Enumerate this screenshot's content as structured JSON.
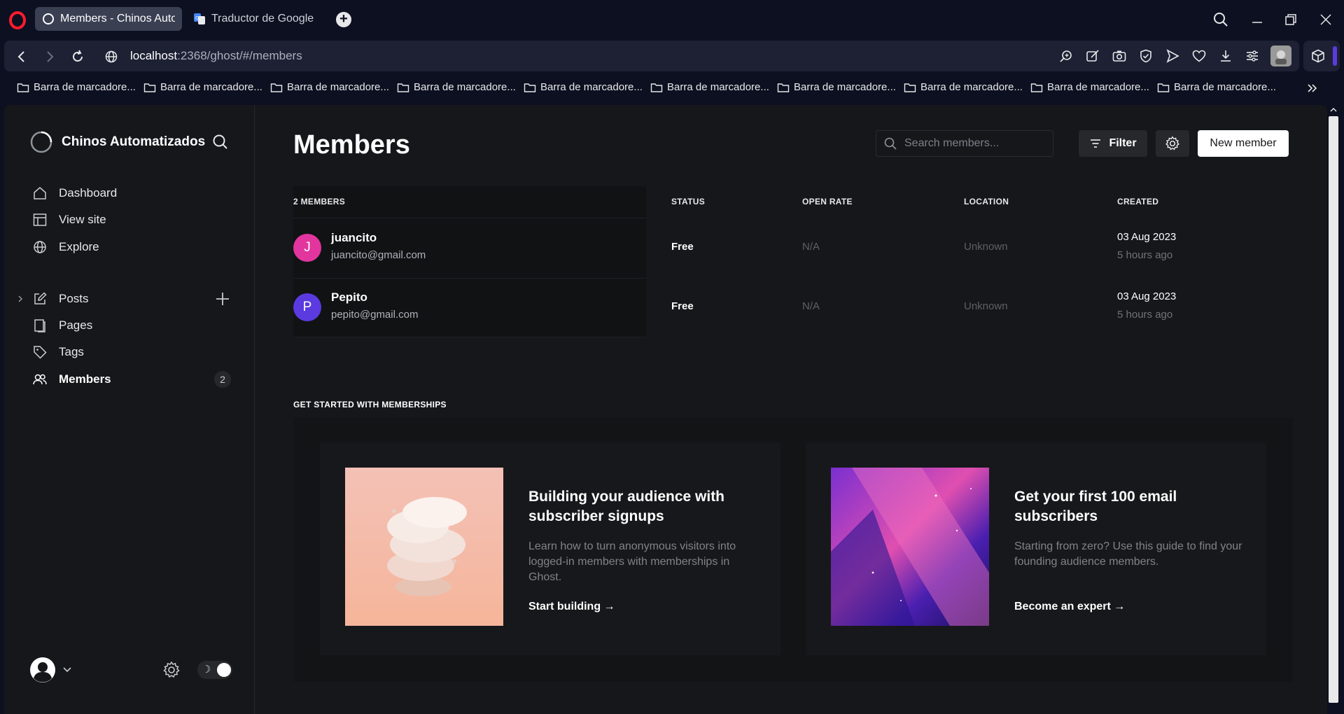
{
  "browser": {
    "tabs": [
      {
        "title": "Members - Chinos Autom",
        "active": true
      },
      {
        "title": "Traductor de Google",
        "active": false
      }
    ],
    "url_host": "localhost",
    "url_rest": ":2368/ghost/#/members",
    "bookmarks": [
      "Barra de marcadore...",
      "Barra de marcadore...",
      "Barra de marcadore...",
      "Barra de marcadore...",
      "Barra de marcadore...",
      "Barra de marcadore...",
      "Barra de marcadore...",
      "Barra de marcadore...",
      "Barra de marcadore...",
      "Barra de marcadore..."
    ]
  },
  "sidebar": {
    "site_name": "Chinos Automatizados",
    "nav": [
      {
        "label": "Dashboard",
        "icon": "home-icon"
      },
      {
        "label": "View site",
        "icon": "layout-icon"
      },
      {
        "label": "Explore",
        "icon": "globe-icon"
      },
      {
        "label": "Posts",
        "icon": "edit-icon"
      },
      {
        "label": "Pages",
        "icon": "pages-icon"
      },
      {
        "label": "Tags",
        "icon": "tag-icon"
      },
      {
        "label": "Members",
        "icon": "users-icon",
        "badge": "2",
        "active": true
      }
    ]
  },
  "main": {
    "title": "Members",
    "search_placeholder": "Search members...",
    "filter_label": "Filter",
    "new_member_label": "New member",
    "table": {
      "headers": [
        "2 MEMBERS",
        "STATUS",
        "OPEN RATE",
        "LOCATION",
        "CREATED"
      ],
      "rows": [
        {
          "initial": "J",
          "name": "juancito",
          "email": "juancito@gmail.com",
          "status": "Free",
          "open_rate": "N/A",
          "location": "Unknown",
          "created": "03 Aug 2023",
          "ago": "5 hours ago",
          "color": "#e2359e"
        },
        {
          "initial": "P",
          "name": "Pepito",
          "email": "pepito@gmail.com",
          "status": "Free",
          "open_rate": "N/A",
          "location": "Unknown",
          "created": "03 Aug 2023",
          "ago": "5 hours ago",
          "color": "#5b3ae0"
        }
      ]
    },
    "get_started": {
      "heading": "GET STARTED WITH MEMBERSHIPS",
      "cards": [
        {
          "title": "Building your audience with subscriber signups",
          "desc": "Learn how to turn anonymous visitors into logged-in members with memberships in Ghost.",
          "link": "Start building →"
        },
        {
          "title": "Get your first 100 email subscribers",
          "desc": "Starting from zero? Use this guide to find your founding audience members.",
          "link": "Become an expert →"
        }
      ]
    }
  },
  "colors": {
    "browser_bg": "#0d1020",
    "app_bg": "#15171a",
    "accent_white": "#ffffff"
  }
}
